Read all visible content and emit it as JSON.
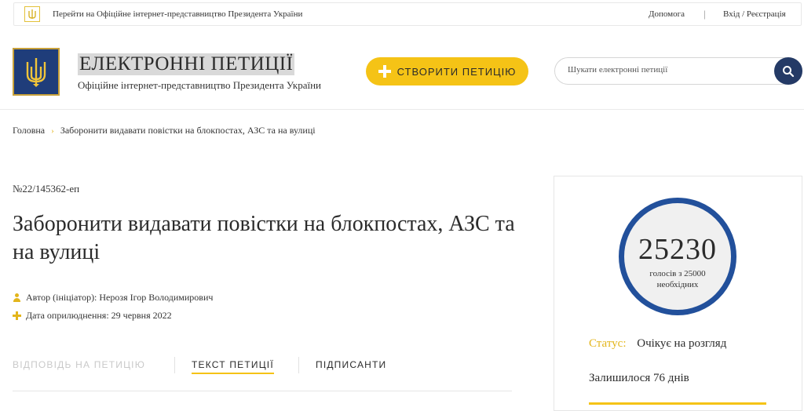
{
  "topbar": {
    "president_link": "Перейти на Офіційне інтернет-представництво Президента України",
    "help": "Допомога",
    "separator": "|",
    "login": "Вхід / Реєстрація"
  },
  "header": {
    "title": "ЕЛЕКТРОННІ ПЕТИЦІЇ",
    "subtitle": "Офіційне інтернет-представництво Президента України",
    "create_button": "СТВОРИТИ ПЕТИЦІЮ",
    "search_placeholder": "Шукати електронні петиції"
  },
  "breadcrumb": {
    "home": "Головна",
    "separator": "›",
    "current": "Заборонити видавати повістки на блокпостах, АЗС та на вулиці"
  },
  "petition": {
    "number": "№22/145362-еп",
    "title": "Заборонити видавати повістки на блокпостах, АЗС та на вулиці",
    "author": "Автор (ініціатор): Нерозя Ігор Володимирович",
    "date": "Дата оприлюднення: 29 червня 2022"
  },
  "tabs": [
    {
      "label": "ВІДПОВІДЬ НА ПЕТИЦІЮ"
    },
    {
      "label": "ТЕКСТ ПЕТИЦІЇ"
    },
    {
      "label": "ПІДПИСАНТИ"
    }
  ],
  "stats": {
    "votes": "25230",
    "votes_of": "голосів з 25000 необхідних",
    "status_label": "Статус:",
    "status_value": "Очікує на розгляд",
    "days_left": "Залишилося 76 днів",
    "progress_fraction": 1.0
  },
  "colors": {
    "accent_yellow": "#f5c316",
    "circle_blue": "#22509b",
    "search_button": "#243a66",
    "logo_blue": "#1f3d7a"
  },
  "icons": {
    "topbar": "trident-icon",
    "logo": "coat-of-arms-icon",
    "create": "plus-icon",
    "search": "magnifier-icon",
    "author": "user-icon",
    "date": "plus-icon",
    "breadcrumb": "chevron-right-icon"
  }
}
